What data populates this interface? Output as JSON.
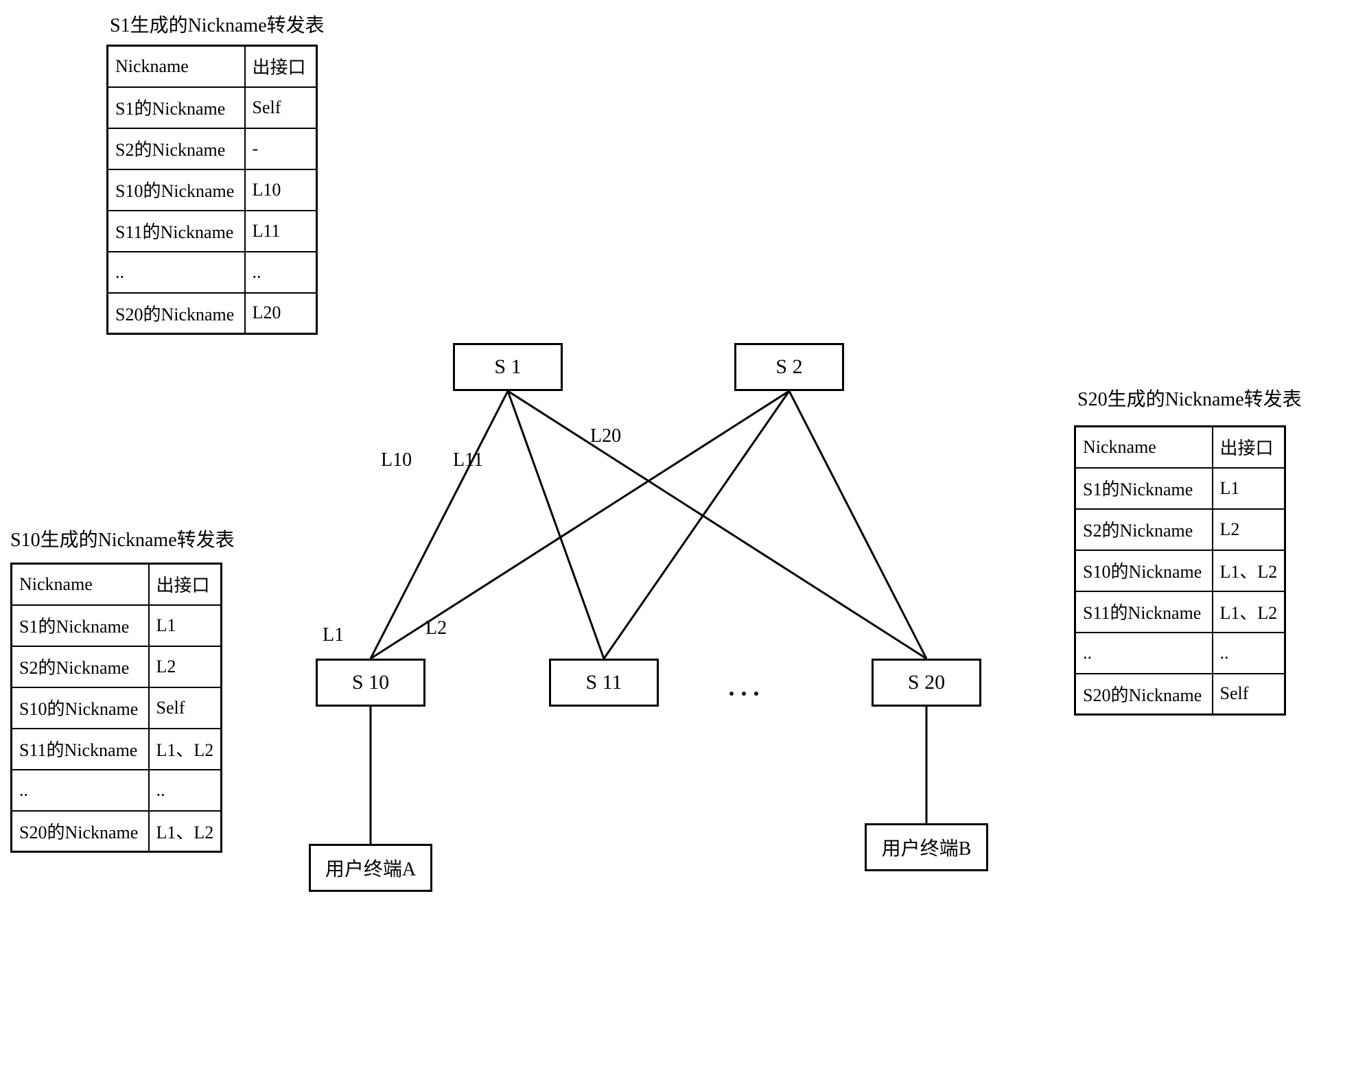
{
  "tables": {
    "s1": {
      "title": "S1生成的Nickname转发表",
      "headers": {
        "h1": "Nickname",
        "h2": "出接口"
      },
      "rows": [
        {
          "c1": "S1的Nickname",
          "c2": "Self"
        },
        {
          "c1": "S2的Nickname",
          "c2": "-"
        },
        {
          "c1": "S10的Nickname",
          "c2": "L10"
        },
        {
          "c1": "S11的Nickname",
          "c2": "L11"
        },
        {
          "c1": "..",
          "c2": ".."
        },
        {
          "c1": "S20的Nickname",
          "c2": "L20"
        }
      ]
    },
    "s10": {
      "title": "S10生成的Nickname转发表",
      "headers": {
        "h1": "Nickname",
        "h2": "出接口"
      },
      "rows": [
        {
          "c1": "S1的Nickname",
          "c2": "L1"
        },
        {
          "c1": "S2的Nickname",
          "c2": "L2"
        },
        {
          "c1": "S10的Nickname",
          "c2": "Self"
        },
        {
          "c1": "S11的Nickname",
          "c2": "L1、L2"
        },
        {
          "c1": "..",
          "c2": ".."
        },
        {
          "c1": "S20的Nickname",
          "c2": "L1、L2"
        }
      ]
    },
    "s20": {
      "title": "S20生成的Nickname转发表",
      "headers": {
        "h1": "Nickname",
        "h2": "出接口"
      },
      "rows": [
        {
          "c1": "S1的Nickname",
          "c2": "L1"
        },
        {
          "c1": "S2的Nickname",
          "c2": "L2"
        },
        {
          "c1": "S10的Nickname",
          "c2": "L1、L2"
        },
        {
          "c1": "S11的Nickname",
          "c2": "L1、L2"
        },
        {
          "c1": "..",
          "c2": ".."
        },
        {
          "c1": "S20的Nickname",
          "c2": "Self"
        }
      ]
    }
  },
  "nodes": {
    "s1": "S 1",
    "s2": "S 2",
    "s10": "S 10",
    "s11": "S 11",
    "s20": "S 20",
    "termA": "用户终端A",
    "termB": "用户终端B"
  },
  "linkLabels": {
    "l10": "L10",
    "l11": "L11",
    "l20": "L20",
    "l1": "L1",
    "l2": "L2"
  },
  "dots": "···"
}
